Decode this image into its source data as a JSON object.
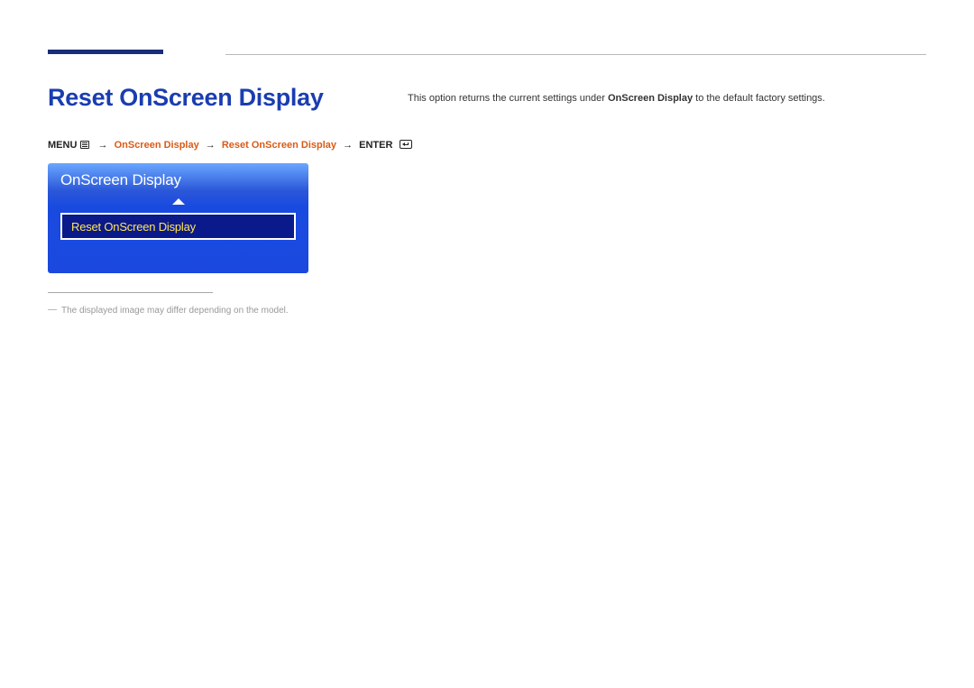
{
  "header": {
    "title": "Reset OnScreen Display"
  },
  "breadcrumb": {
    "menu_label": "MENU",
    "path_1": "OnScreen Display",
    "path_2": "Reset OnScreen Display",
    "enter_label": "ENTER"
  },
  "description": {
    "prefix": "This option returns the current settings under ",
    "bold": "OnScreen Display",
    "suffix": " to the default factory settings."
  },
  "osd": {
    "panel_title": "OnScreen Display",
    "selected_item": "Reset OnScreen Display"
  },
  "footnote": {
    "text": "The displayed image may differ depending on the model."
  }
}
